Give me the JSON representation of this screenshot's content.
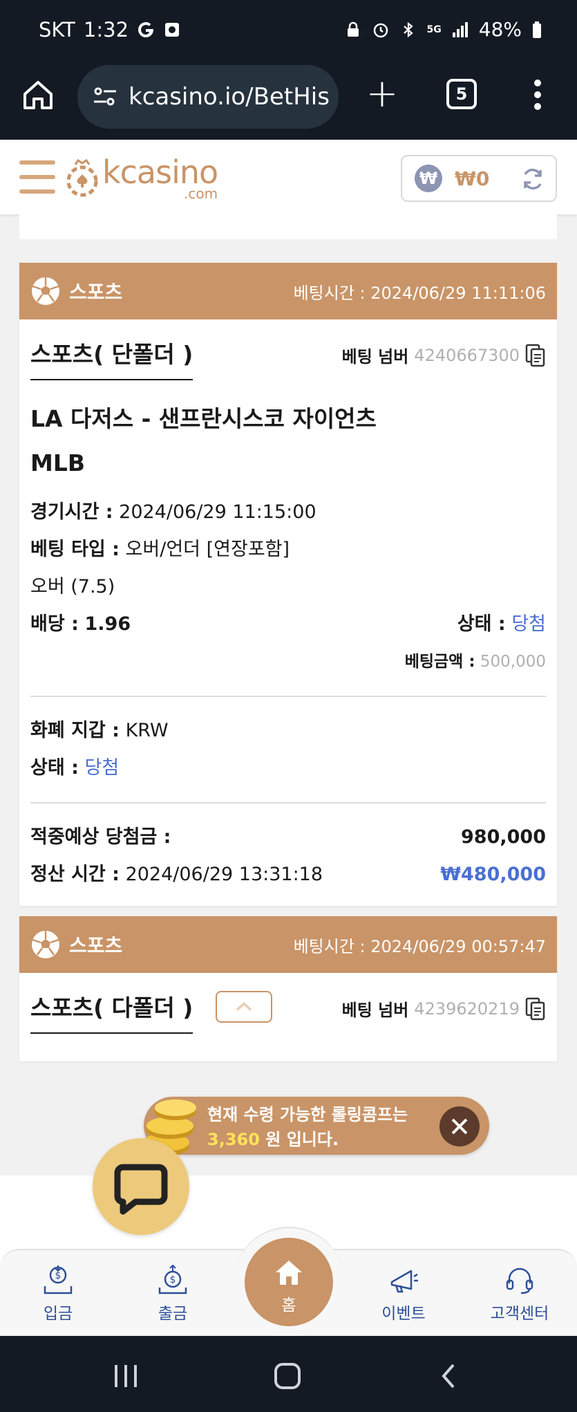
{
  "status_bar": {
    "carrier": "SKT",
    "time": "1:32",
    "battery": "48%",
    "network": "5G"
  },
  "browser": {
    "url": "kcasino.io/BetHis",
    "tab_count": "5"
  },
  "header": {
    "logo_text": "kcasino",
    "logo_sub": ".com",
    "balance": "₩0"
  },
  "cards": [
    {
      "category": "스포츠",
      "bet_time": "베팅시간 : 2024/06/29 11:11:06",
      "bet_type": "스포츠( 단폴더 )",
      "bet_number_label": "베팅 넘버",
      "bet_number": "4240667300",
      "match": "LA 다저스 - 샌프란시스코 자이언츠",
      "league": "MLB",
      "game_time_label": "경기시간 :",
      "game_time": "2024/06/29 11:15:00",
      "betting_type_label": "베팅 타입 :",
      "betting_type": "오버/언더 [연장포함]",
      "selection": "오버 (7.5)",
      "odds_label": "배당 :",
      "odds": "1.96",
      "status_label": "상태 :",
      "status": "당첨",
      "amount_label": "베팅금액 :",
      "amount": "500,000",
      "wallet_label": "화폐 지갑 :",
      "wallet": "KRW",
      "status2_label": "상태 :",
      "status2": "당첨",
      "expected_label": "적중예상 당첨금 :",
      "expected": "980,000",
      "settle_label": "정산 시간 :",
      "settle_time": "2024/06/29 13:31:18",
      "payout": "₩480,000"
    },
    {
      "category": "스포츠",
      "bet_time": "베팅시간 : 2024/06/29 00:57:47",
      "bet_type": "스포츠( 다폴더 )",
      "bet_number_label": "베팅 넘버",
      "bet_number": "4239620219"
    }
  ],
  "promo": {
    "line1": "현재 수령 가능한 롤링콤프는",
    "amount": "3,360",
    "line2_suffix": "원 입니다."
  },
  "bottom_nav": [
    {
      "label": "입금",
      "icon": "deposit-icon"
    },
    {
      "label": "출금",
      "icon": "withdraw-icon"
    },
    {
      "label": "홈",
      "icon": "home-icon"
    },
    {
      "label": "이벤트",
      "icon": "megaphone-icon"
    },
    {
      "label": "고객센터",
      "icon": "headset-icon"
    }
  ],
  "colors": {
    "accent": "#c99467",
    "link": "#4a6fd1",
    "dark_bar": "#141a24"
  }
}
